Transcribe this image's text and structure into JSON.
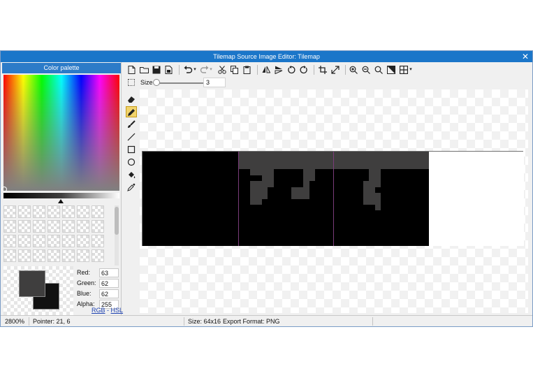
{
  "window": {
    "title": "Tilemap Source Image Editor: Tilemap",
    "close_icon": "✕"
  },
  "palette": {
    "header": "Color palette",
    "primary_color": "#3f3e3e",
    "secondary_color": "#111111",
    "red_label": "Red:",
    "red": "63",
    "green_label": "Green:",
    "green": "62",
    "blue_label": "Blue:",
    "blue": "62",
    "alpha_label": "Alpha:",
    "alpha": "255",
    "mode_rgb": "RGB",
    "mode_sep": "-",
    "mode_hsl": "HSL"
  },
  "toolbar": {
    "icons": [
      "new-file-icon",
      "open-folder-icon",
      "save-icon",
      "save-as-icon",
      "undo-icon",
      "redo-icon",
      "cut-icon",
      "copy-icon",
      "paste-icon",
      "flip-horizontal-icon",
      "flip-vertical-icon",
      "rotate-left-icon",
      "rotate-right-icon",
      "crop-icon",
      "resize-icon",
      "zoom-in-icon",
      "zoom-out-icon",
      "zoom-fit-icon",
      "zoom-actual-icon",
      "grid-icon"
    ]
  },
  "size": {
    "label": "Size",
    "value": "3",
    "fraction": 0.0
  },
  "tools": [
    "select-icon",
    "eraser-icon",
    "pencil-icon",
    "brush-icon",
    "line-icon",
    "rectangle-icon",
    "ellipse-icon",
    "fill-bucket-icon",
    "eyedropper-icon"
  ],
  "canvas": {
    "tile_count": 4,
    "tile_colors": [
      "#000000",
      "#000000",
      "#000000",
      "#ffffff"
    ],
    "pixel_color": "#3f3e3e"
  },
  "status": {
    "zoom": "2800%",
    "pointer": "Pointer: 21, 6",
    "size": "Size: 64x16",
    "export": "Export Format: PNG"
  }
}
